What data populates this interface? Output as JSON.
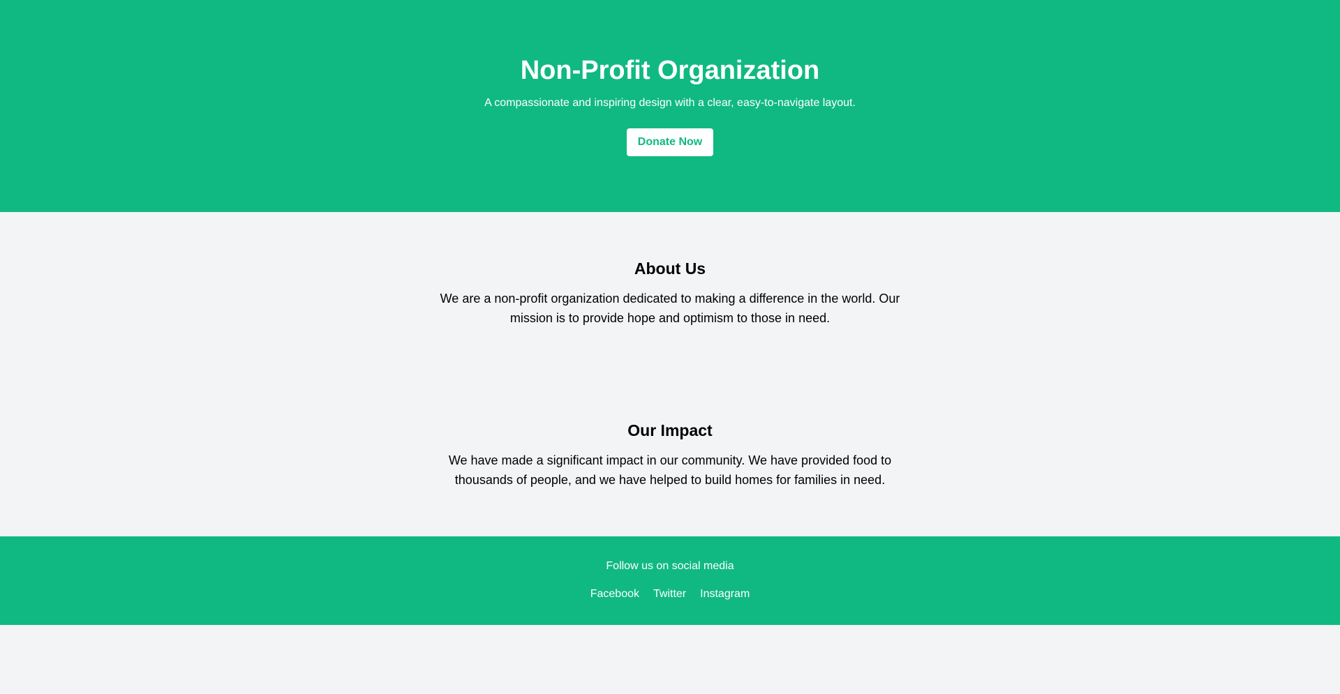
{
  "hero": {
    "title": "Non-Profit Organization",
    "subtitle": "A compassionate and inspiring design with a clear, easy-to-navigate layout.",
    "donate_label": "Donate Now"
  },
  "about": {
    "heading": "About Us",
    "body": "We are a non-profit organization dedicated to making a difference in the world. Our mission is to provide hope and optimism to those in need."
  },
  "impact": {
    "heading": "Our Impact",
    "body": "We have made a significant impact in our community. We have provided food to thousands of people, and we have helped to build homes for families in need."
  },
  "footer": {
    "text": "Follow us on social media",
    "links": [
      "Facebook",
      "Twitter",
      "Instagram"
    ]
  },
  "colors": {
    "brand_green": "#10b981",
    "page_background": "#f3f4f6",
    "text": "#000000",
    "on_brand": "#ffffff"
  }
}
